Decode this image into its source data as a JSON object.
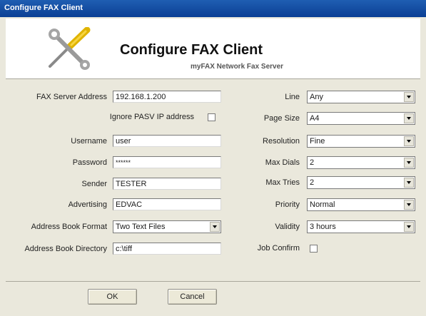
{
  "window": {
    "title": "Configure FAX Client"
  },
  "header": {
    "title": "Configure FAX Client",
    "subtitle": "myFAX Network Fax Server",
    "icon": "tools-icon"
  },
  "left": {
    "server_address": {
      "label": "FAX Server Address",
      "value": "192.168.1.200"
    },
    "ignore_pasv": {
      "label": "Ignore PASV IP address",
      "checked": false
    },
    "username": {
      "label": "Username",
      "value": "user"
    },
    "password": {
      "label": "Password",
      "value": "******"
    },
    "sender": {
      "label": "Sender",
      "value": "TESTER"
    },
    "advertising": {
      "label": "Advertising",
      "value": "EDVAC"
    },
    "ab_format": {
      "label": "Address Book Format",
      "value": "Two Text Files"
    },
    "ab_directory": {
      "label": "Address Book Directory",
      "value": "c:\\tiff"
    }
  },
  "right": {
    "line": {
      "label": "Line",
      "value": "Any"
    },
    "page_size": {
      "label": "Page Size",
      "value": "A4"
    },
    "resolution": {
      "label": "Resolution",
      "value": "Fine"
    },
    "max_dials": {
      "label": "Max Dials",
      "value": "2"
    },
    "max_tries": {
      "label": "Max Tries",
      "value": "2"
    },
    "priority": {
      "label": "Priority",
      "value": "Normal"
    },
    "validity": {
      "label": "Validity",
      "value": "3 hours"
    },
    "job_confirm": {
      "label": "Job Confirm",
      "checked": false
    }
  },
  "buttons": {
    "ok": "OK",
    "cancel": "Cancel"
  }
}
